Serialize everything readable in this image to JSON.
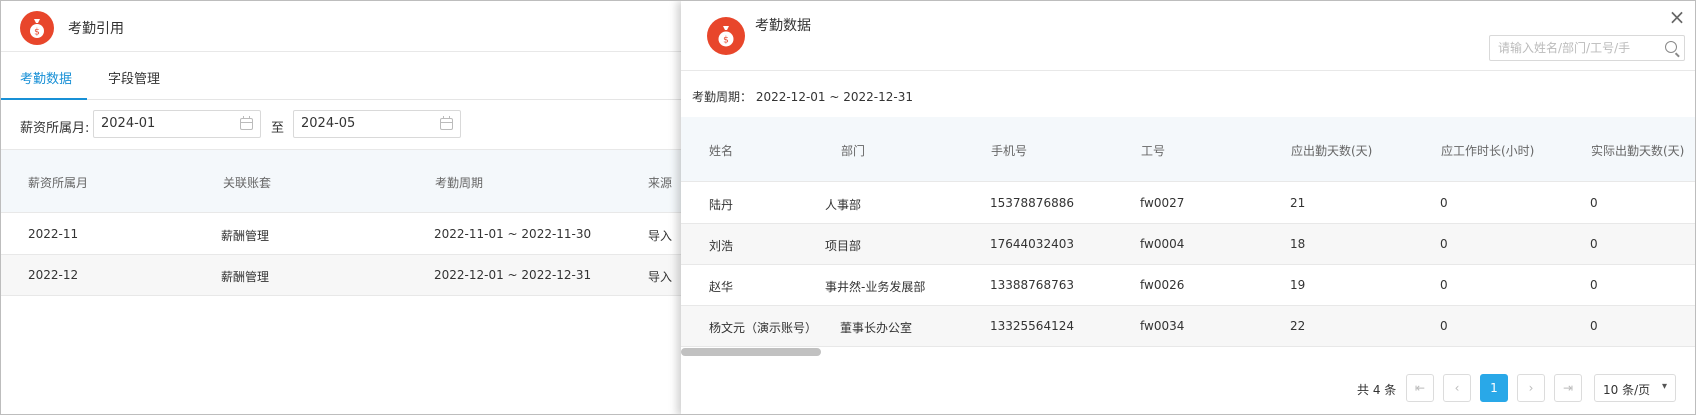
{
  "left": {
    "title": "考勤引用",
    "tabs": [
      "考勤数据",
      "字段管理"
    ],
    "filter": {
      "label": "薪资所属月:",
      "from": "2024-01",
      "to_label": "至",
      "to": "2024-05"
    },
    "table": {
      "headers": [
        "薪资所属月",
        "关联账套",
        "考勤周期",
        "来源"
      ],
      "rows": [
        [
          "2022-11",
          "薪酬管理",
          "2022-11-01 ~ 2022-11-30",
          "导入"
        ],
        [
          "2022-12",
          "薪酬管理",
          "2022-12-01 ~ 2022-12-31",
          "导入"
        ]
      ]
    }
  },
  "drawer": {
    "title": "考勤数据",
    "search_placeholder": "请输入姓名/部门/工号/手",
    "period": "考勤周期： 2022-12-01 ~ 2022-12-31",
    "headers": [
      "姓名",
      "部门",
      "手机号",
      "工号",
      "应出勤天数(天)",
      "应工作时长(小时)",
      "实际出勤天数(天)"
    ],
    "rows": [
      [
        "陆丹",
        "人事部",
        "15378876886",
        "fw0027",
        "21",
        "0",
        "0"
      ],
      [
        "刘浩",
        "项目部",
        "17644032403",
        "fw0004",
        "18",
        "0",
        "0"
      ],
      [
        "赵华",
        "事井然-业务发展部",
        "13388768763",
        "fw0026",
        "19",
        "0",
        "0"
      ],
      [
        "杨文元（演示账号）",
        "董事长办公室",
        "13325564124",
        "fw0034",
        "22",
        "0",
        "0"
      ]
    ],
    "pagination": {
      "total": "共 4 条",
      "current": "1",
      "page_size": "10 条/页"
    },
    "icons": {
      "close": "close-icon",
      "search": "search-icon",
      "money": "money-bag-icon"
    },
    "colors": {
      "accent": "#1890d6",
      "brand": "#e8462b",
      "page_active": "#29a8e8"
    }
  }
}
